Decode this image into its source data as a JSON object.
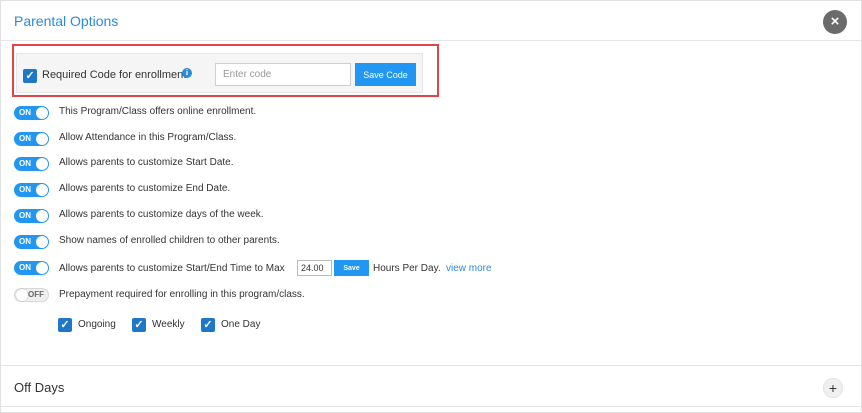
{
  "header": {
    "title": "Parental Options",
    "close_symbol": "×"
  },
  "code_section": {
    "checkbox_checked": true,
    "label": "Required Code for enrollment",
    "info_symbol": "i",
    "input_value": "",
    "input_placeholder": "Enter code",
    "save_label": "Save Code"
  },
  "toggle_on_label": "ON",
  "toggle_off_label": "OFF",
  "check_symbol": "✓",
  "options": [
    {
      "state": "ON",
      "label": "This Program/Class offers online enrollment."
    },
    {
      "state": "ON",
      "label": "Allow Attendance in this Program/Class."
    },
    {
      "state": "ON",
      "label": "Allows parents to customize Start Date."
    },
    {
      "state": "ON",
      "label": "Allows parents to customize End Date."
    },
    {
      "state": "ON",
      "label": "Allows parents to customize days of the week."
    },
    {
      "state": "ON",
      "label": "Show names of enrolled children to other parents."
    },
    {
      "state": "ON",
      "label": "Allows parents to customize Start/End Time to Max",
      "hours_value": "24.00",
      "save_label": "Save",
      "suffix": "Hours Per Day.",
      "link": "view more"
    },
    {
      "state": "OFF",
      "label": "Prepayment required for enrolling in this program/class."
    }
  ],
  "schedule_types": [
    {
      "label": "Ongoing",
      "checked": true
    },
    {
      "label": "Weekly",
      "checked": true
    },
    {
      "label": "One Day",
      "checked": true
    }
  ],
  "off_days": {
    "title": "Off Days",
    "expand_symbol": "+"
  },
  "colors": {
    "accent": "#2196f3",
    "highlight_border": "#e0454b",
    "title": "#2d8ad8"
  }
}
